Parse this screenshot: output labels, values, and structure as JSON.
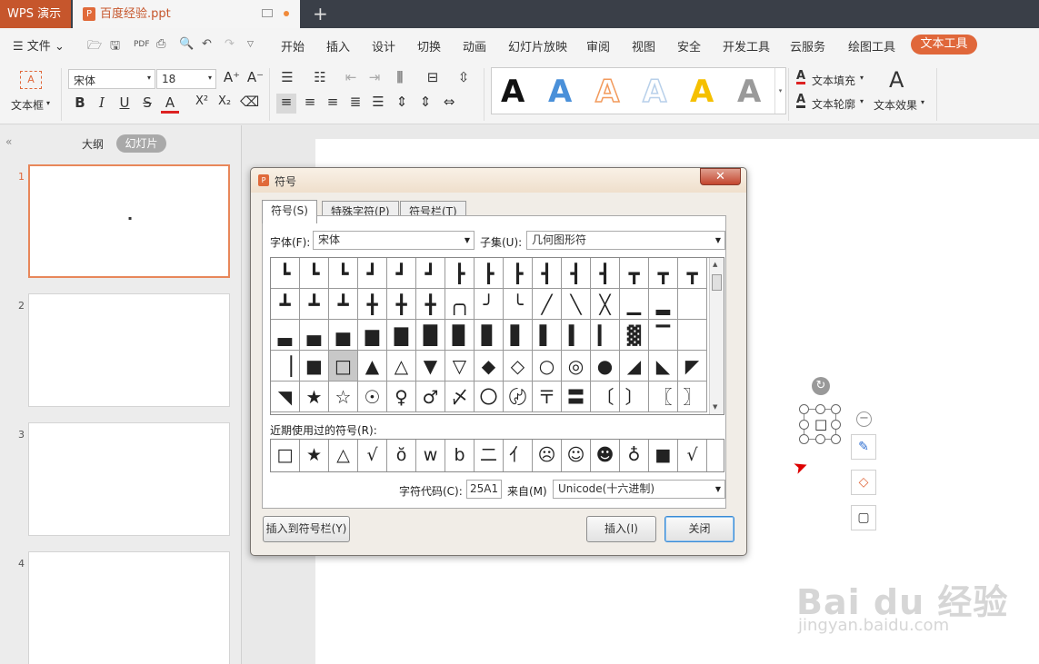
{
  "titlebar": {
    "app_name": "WPS 演示",
    "doc_tab": "百度经验.ppt"
  },
  "menubar": {
    "file": "文件",
    "items": [
      "开始",
      "插入",
      "设计",
      "切换",
      "动画",
      "幻灯片放映",
      "审阅",
      "视图",
      "安全",
      "开发工具",
      "云服务",
      "绘图工具"
    ],
    "active": "文本工具"
  },
  "ribbon": {
    "textbox_label": "文本框",
    "font_name": "宋体",
    "font_size": "18",
    "text_fill": "文本填充",
    "text_outline": "文本轮廓",
    "text_effect": "文本效果",
    "format_buttons": {
      "bold": "B",
      "italic": "I",
      "underline": "U",
      "strike": "S",
      "color": "A",
      "superscript": "X²",
      "subscript": "X₂"
    },
    "wordart": [
      {
        "glyph": "A",
        "color": "#111111"
      },
      {
        "glyph": "A",
        "color": "#4a90d9"
      },
      {
        "glyph": "A",
        "color": "#f29a5c"
      },
      {
        "glyph": "A",
        "color": "#b8d0ea"
      },
      {
        "glyph": "A",
        "color": "#f5c000"
      },
      {
        "glyph": "A",
        "color": "#9a9a9a"
      }
    ]
  },
  "leftpanel": {
    "tab_outline": "大纲",
    "tab_slides": "幻灯片",
    "slides": [
      "1",
      "2",
      "3",
      "4"
    ]
  },
  "dialog": {
    "title": "符号",
    "close": "✕",
    "tabs": [
      "符号(S)",
      "特殊字符(P)",
      "符号栏(T)"
    ],
    "font_label": "字体(F):",
    "font_value": "宋体",
    "subset_label": "子集(U):",
    "subset_value": "几何图形符",
    "recent_label": "近期使用过的符号(R):",
    "charcode_label": "字符代码(C):",
    "charcode_value": "25A1",
    "from_label": "来自(M)",
    "from_value": "Unicode(十六进制)",
    "btn_insert_bar": "插入到符号栏(Y)",
    "btn_insert": "插入(I)",
    "btn_close": "关闭",
    "grid": [
      [
        "┗",
        "┗",
        "┗",
        "┛",
        "┛",
        "┛",
        "┣",
        "┣",
        "┣",
        "┫",
        "┫",
        "┫",
        "┳",
        "┳",
        "┳"
      ],
      [
        "┻",
        "┻",
        "┻",
        "╋",
        "╋",
        "╋",
        "╭╮",
        "╯",
        "╰",
        "╱",
        "╲",
        "╳",
        "▁",
        "▂",
        ""
      ],
      [
        "▃",
        "▄",
        "▅",
        "▆",
        "▇",
        "█",
        "▉",
        "▊",
        "▋",
        "▌",
        "▍",
        "▎",
        "▓",
        "▔",
        ""
      ],
      [
        "▕",
        "■",
        "□",
        "▲",
        "△",
        "▼",
        "▽",
        "◆",
        "◇",
        "○",
        "◎",
        "●",
        "◢",
        "◣",
        "◤"
      ],
      [
        "◥",
        "★",
        "☆",
        "☉",
        "♀",
        "♂",
        "〆",
        "〇",
        "〄",
        "〒",
        "〓",
        "〔",
        "〕",
        "〖",
        "〗"
      ]
    ],
    "recent": [
      "□",
      "★",
      "△",
      "√",
      "ŏ",
      "w",
      "b",
      "二",
      "亻",
      "☹",
      "☺",
      "☻",
      "♁",
      "■",
      "√"
    ]
  },
  "watermark": {
    "brand": "Bai du 经验",
    "url": "jingyan.baidu.com"
  }
}
